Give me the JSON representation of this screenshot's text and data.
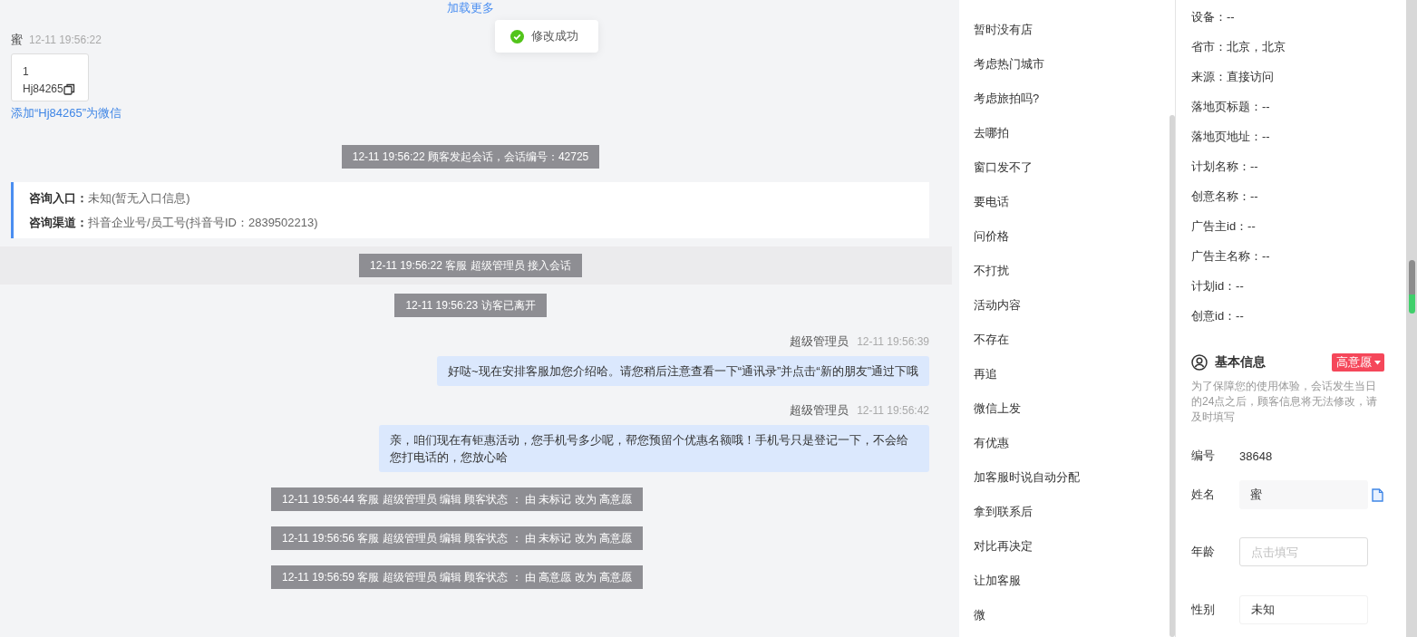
{
  "load_more": "加载更多",
  "toast": {
    "text": "修改成功"
  },
  "messages": [
    {
      "kind": "customer_card",
      "name": "蜜",
      "time": "12-11 19:56:22",
      "card_lines": [
        "1",
        "Hj84265"
      ],
      "link": "添加“Hj84265”为微信"
    },
    {
      "kind": "notice",
      "text": "12-11 19:56:22 顾客发起会话，会话编号：42725",
      "highlighted": false
    },
    {
      "kind": "entry_info",
      "rows": [
        {
          "label": "咨询入口：",
          "value": "未知(暂无入口信息)"
        },
        {
          "label": "咨询渠道：",
          "value": "抖音企业号/员工号(抖音号ID：2839502213)"
        }
      ]
    },
    {
      "kind": "notice",
      "text": "12-11 19:56:22 客服 超级管理员 接入会话",
      "highlighted": true
    },
    {
      "kind": "notice",
      "text": "12-11 19:56:23 访客已离开",
      "highlighted": false
    },
    {
      "kind": "agent",
      "name": "超级管理员",
      "time": "12-11 19:56:39",
      "text": "好哒~现在安排客服加您介绍哈。请您稍后注意查看一下“通讯录”并点击“新的朋友”通过下哦"
    },
    {
      "kind": "agent",
      "name": "超级管理员",
      "time": "12-11 19:56:42",
      "text": "亲，咱们现在有钜惠活动，您手机号多少呢，帮您预留个优惠名额哦！手机号只是登记一下，不会给您打电话的，您放心哈"
    },
    {
      "kind": "status_log",
      "text": "12-11 19:56:44 客服 超级管理员 编辑 顾客状态 ： 由 未标记 改为 高意愿"
    },
    {
      "kind": "status_log",
      "text": "12-11 19:56:56 客服 超级管理员 编辑 顾客状态 ： 由 未标记 改为 高意愿"
    },
    {
      "kind": "status_log",
      "text": "12-11 19:56:59 客服 超级管理员 编辑 顾客状态 ： 由 高意愿 改为 高意愿"
    }
  ],
  "quick_replies": [
    "暂时没有店",
    "考虑热门城市",
    "考虑旅拍吗?",
    "去哪拍",
    "窗口发不了",
    "要电话",
    "问价格",
    "不打扰",
    "活动内容",
    "不存在",
    "再追",
    "微信上发",
    "有优惠",
    "加客服时说自动分配",
    "拿到联系后",
    "对比再决定",
    "让加客服",
    "微"
  ],
  "visitor_info": [
    "设备：--",
    "省市：北京，北京",
    "来源：直接访问",
    "落地页标题：--",
    "落地页地址：--",
    "计划名称：--",
    "创意名称：--",
    "广告主id：--",
    "广告主名称：--",
    "计划id：--",
    "创意id：--"
  ],
  "basic_info": {
    "title": "基本信息",
    "tag": {
      "text": "高意愿",
      "color": "#f5475a"
    },
    "note": "为了保障您的使用体验，会话发生当日的24点之后，顾客信息将无法修改，请及时填写",
    "fields": [
      {
        "kind": "text",
        "label": "编号",
        "value": "38648"
      },
      {
        "kind": "readonly",
        "label": "姓名",
        "value": "蜜"
      },
      {
        "kind": "input",
        "label": "年龄",
        "placeholder": "点击填写"
      },
      {
        "kind": "select",
        "label": "性别",
        "value": "未知"
      }
    ]
  }
}
